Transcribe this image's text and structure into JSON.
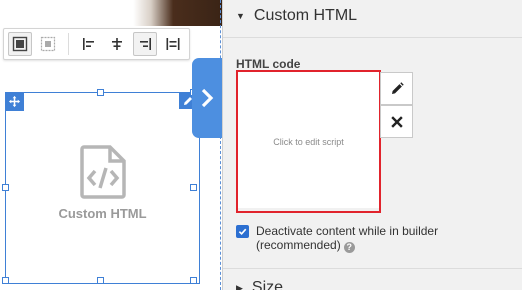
{
  "panel": {
    "section_title": "Custom HTML",
    "html_code_label": "HTML code",
    "script_placeholder": "Click to edit script",
    "deactivate_label": "Deactivate content while in builder (recommended)",
    "deactivate_checked": true,
    "next_section_title": "Size"
  },
  "canvas": {
    "block_label": "Custom HTML"
  },
  "toolbar": {
    "tools": [
      "full-width",
      "boxed",
      "align-left",
      "align-center",
      "align-right",
      "justify"
    ]
  },
  "colors": {
    "accent": "#3f80d6",
    "tab": "#4d8fe0",
    "highlight": "#e1232c",
    "panel_bg": "#f1f1f1"
  }
}
